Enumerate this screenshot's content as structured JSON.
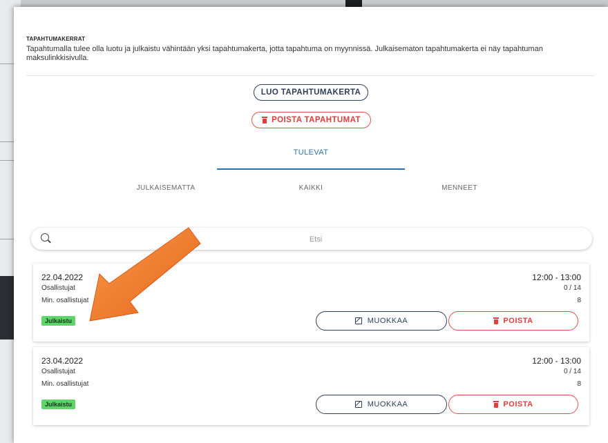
{
  "section": {
    "title": "TAPAHTUMAKERRAT",
    "description": "Tapahtumalla tulee olla luotu ja julkaistu vähintään yksi tapahtumakerta, jotta tapahtuma on myynnissä. Julkaisematon tapahtumakerta ei näy tapahtuman maksulinkkisivulla."
  },
  "actions": {
    "create_label": "LUO TAPAHTUMAKERTA",
    "delete_all_label": "POISTA TAPAHTUMAT"
  },
  "tabs": {
    "upcoming": "TULEVAT",
    "unpublished": "JULKAISEMATTA",
    "all": "KAIKKI",
    "past": "MENNEET"
  },
  "search": {
    "placeholder": "Etsi",
    "value": ""
  },
  "events": [
    {
      "date": "22.04.2022",
      "time": "12:00 - 13:00",
      "participants_label": "Osallistujat",
      "participants_value": "0 / 14",
      "min_label": "Min. osallistujat",
      "min_value": "8",
      "status": "Julkaistu",
      "edit_label": "MUOKKAA",
      "delete_label": "POISTA"
    },
    {
      "date": "23.04.2022",
      "time": "12:00 - 13:00",
      "participants_label": "Osallistujat",
      "participants_value": "0 / 14",
      "min_label": "Min. osallistujat",
      "min_value": "8",
      "status": "Julkaistu",
      "edit_label": "MUOKKAA",
      "delete_label": "POISTA"
    }
  ],
  "colors": {
    "primary": "#2c3e5a",
    "danger": "#e03c3c",
    "active_tab": "#2d6fa8",
    "published_badge": "#5fd46a",
    "annotation_arrow": "#f07a26"
  }
}
